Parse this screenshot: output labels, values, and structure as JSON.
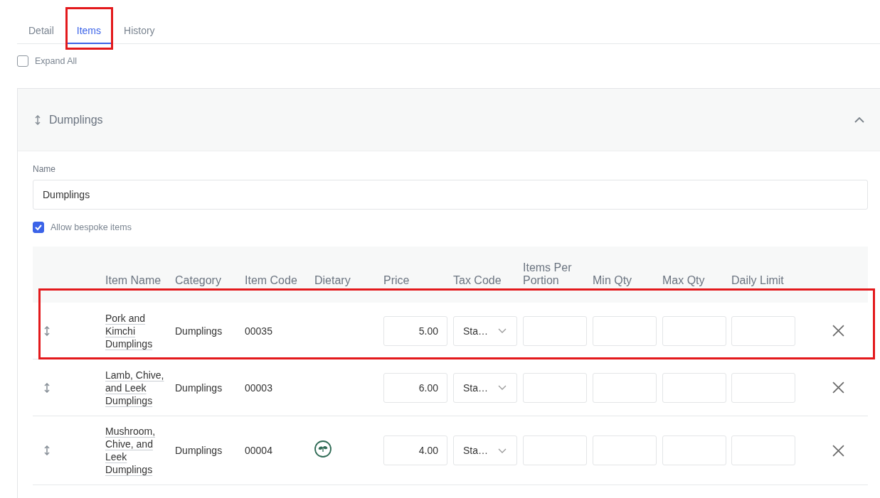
{
  "tabs": [
    {
      "label": "Detail",
      "selected": false,
      "highlighted": false
    },
    {
      "label": "Items",
      "selected": true,
      "highlighted": true
    },
    {
      "label": "History",
      "selected": false,
      "highlighted": false
    }
  ],
  "expand_all": {
    "label": "Expand All",
    "checked": false
  },
  "section": {
    "title": "Dumplings",
    "expanded": true,
    "name_label": "Name",
    "name_value": "Dumplings",
    "bespoke": {
      "label": "Allow bespoke items",
      "checked": true
    }
  },
  "table": {
    "columns": [
      "Item Name",
      "Category",
      "Item Code",
      "Dietary",
      "Price",
      "Tax Code",
      "Items Per Portion",
      "Min Qty",
      "Max Qty",
      "Daily Limit"
    ],
    "rows": [
      {
        "item_name": "Pork and Kimchi Dumplings",
        "category": "Dumplings",
        "item_code": "00035",
        "vegetarian": false,
        "price": "5.00",
        "tax_code": "Sta…",
        "highlighted": true
      },
      {
        "item_name": "Lamb, Chive, and Leek Dumplings",
        "category": "Dumplings",
        "item_code": "00003",
        "vegetarian": false,
        "price": "6.00",
        "tax_code": "Sta…",
        "highlighted": false
      },
      {
        "item_name": "Mushroom, Chive, and Leek Dumplings",
        "category": "Dumplings",
        "item_code": "00004",
        "vegetarian": true,
        "price": "4.00",
        "tax_code": "Sta…",
        "highlighted": false
      }
    ]
  }
}
